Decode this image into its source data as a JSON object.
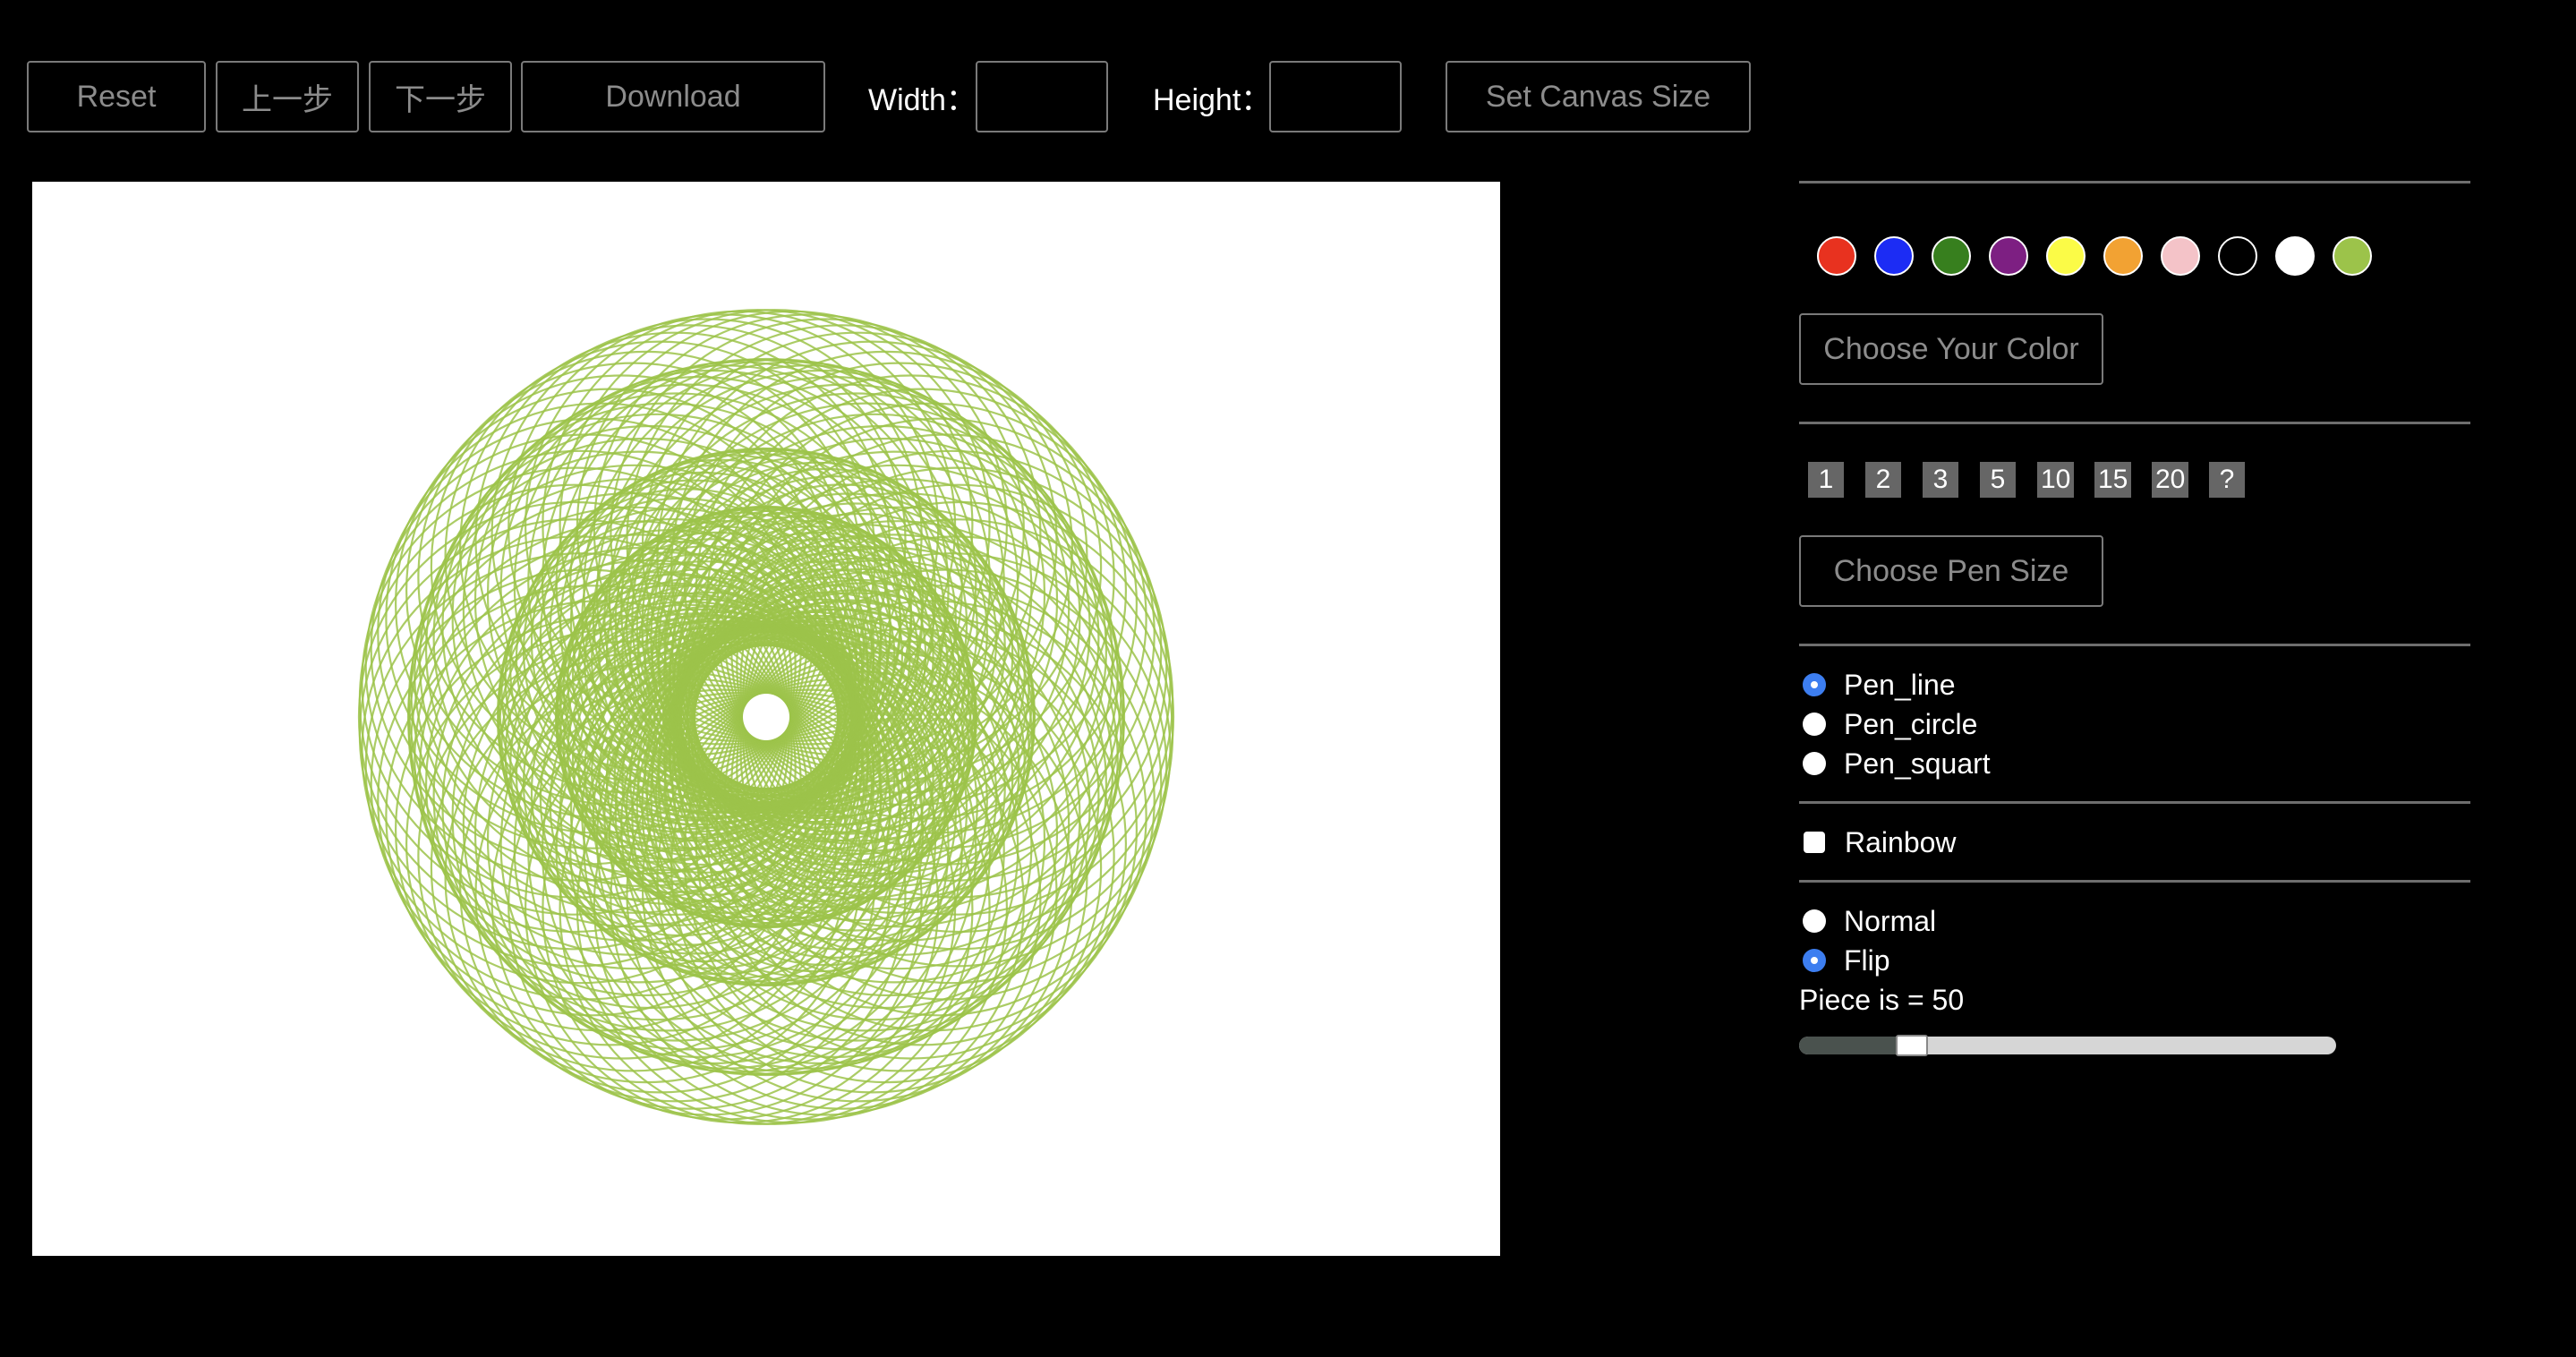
{
  "toolbar": {
    "reset": "Reset",
    "undo": "上一步",
    "redo": "下一步",
    "download": "Download",
    "width_label": "Width：",
    "width_value": "",
    "height_label": "Height：",
    "height_value": "",
    "set_size": "Set Canvas Size"
  },
  "canvas": {
    "background": "#ffffff",
    "stroke_color": "#9cc34a",
    "pieces": 50
  },
  "panel": {
    "colors": [
      {
        "name": "red",
        "hex": "#e8321f"
      },
      {
        "name": "blue",
        "hex": "#1c2cf4"
      },
      {
        "name": "green",
        "hex": "#377f1e"
      },
      {
        "name": "purple",
        "hex": "#7d1f82"
      },
      {
        "name": "yellow",
        "hex": "#fbfb47"
      },
      {
        "name": "orange",
        "hex": "#f2a233"
      },
      {
        "name": "pink",
        "hex": "#f4c3c8"
      },
      {
        "name": "black",
        "hex": "#000000"
      },
      {
        "name": "white",
        "hex": "#ffffff"
      },
      {
        "name": "yellow-green",
        "hex": "#9cc34a"
      }
    ],
    "choose_color": "Choose Your Color",
    "pen_sizes": [
      "1",
      "2",
      "3",
      "5",
      "10",
      "15",
      "20",
      "?"
    ],
    "choose_pen_size": "Choose Pen Size",
    "pen_types": [
      {
        "label": "Pen_line",
        "checked": true
      },
      {
        "label": "Pen_circle",
        "checked": false
      },
      {
        "label": "Pen_squart",
        "checked": false
      }
    ],
    "rainbow": {
      "label": "Rainbow",
      "checked": false
    },
    "modes": [
      {
        "label": "Normal",
        "checked": false
      },
      {
        "label": "Flip",
        "checked": true
      }
    ],
    "piece_text": "Piece is = 50",
    "slider_fraction": 0.18
  }
}
